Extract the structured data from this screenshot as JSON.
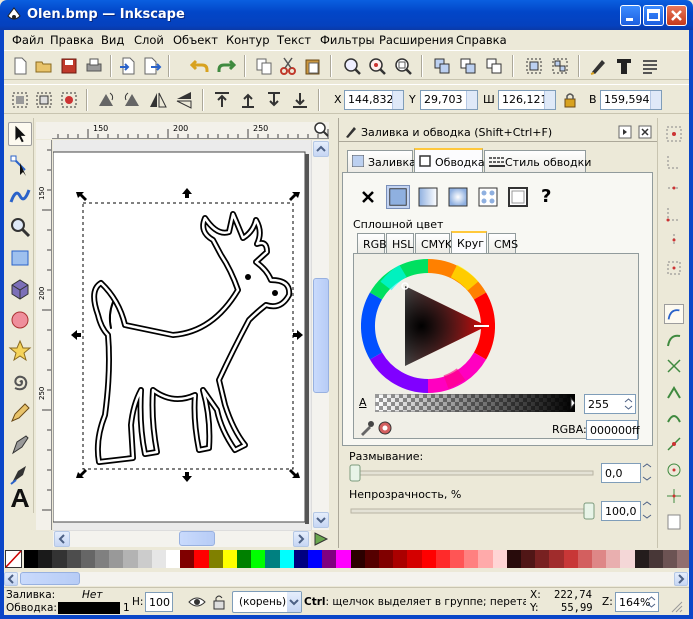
{
  "window": {
    "title": "Olen.bmp — Inkscape",
    "title_icon": "inkscape-icon",
    "controls": [
      "minimize-icon",
      "maximize-icon",
      "close-icon"
    ]
  },
  "menu": [
    "Файл",
    "Правка",
    "Вид",
    "Слой",
    "Объект",
    "Контур",
    "Текст",
    "Фильтры",
    "Расширения",
    "Справка"
  ],
  "toolbar_main": {
    "icons": [
      "new-icon",
      "open-icon",
      "save-icon",
      "print-icon",
      "import-icon",
      "export-icon",
      "undo-icon",
      "redo-icon",
      "copy-icon",
      "cut-icon",
      "paste-icon",
      "zoom-selection-icon",
      "zoom-drawing-icon",
      "zoom-page-icon",
      "duplicate-icon",
      "clone-icon",
      "unlink-clone-icon",
      "group-icon",
      "ungroup-icon",
      "fill-stroke-icon",
      "text-font-icon",
      "xml-editor-icon"
    ]
  },
  "toolbar_select": {
    "x_label": "X",
    "x_value": "144,832",
    "y_label": "Y",
    "y_value": "29,703",
    "w_label": "Ш",
    "w_value": "126,121",
    "h_label": "В",
    "h_value": "159,594",
    "lock_icon": "lock-icon"
  },
  "rulers": {
    "h_labels": [
      "150",
      "200",
      "250"
    ],
    "v_labels": [
      "150",
      "200",
      "250"
    ]
  },
  "left_tools": [
    "selector-tool-icon",
    "node-tool-icon",
    "tweak-tool-icon",
    "zoom-tool-icon",
    "rect-tool-icon",
    "3dbox-tool-icon",
    "ellipse-tool-icon",
    "star-tool-icon",
    "spiral-tool-icon",
    "pencil-tool-icon",
    "pen-tool-icon",
    "calligraphy-tool-icon",
    "text-tool-icon"
  ],
  "dock": {
    "title": "Заливка и обводка (Shift+Ctrl+F)",
    "tabs": [
      "Заливка",
      "Обводка",
      "Стиль обводки"
    ],
    "active_tab": "Обводка",
    "paint_modes": [
      "no-paint",
      "flat-color",
      "linear-gradient",
      "radial-gradient",
      "pattern",
      "swatch",
      "unset"
    ],
    "unset_glyph": "?",
    "section_label": "Сплошной цвет",
    "color_tabs": [
      "RGB",
      "HSL",
      "CMYK",
      "Круг",
      "CMS"
    ],
    "active_color_tab": "Круг",
    "alpha_label": "A",
    "alpha_value": "255",
    "rgba_label": "RGBA:",
    "rgba_value": "000000ff",
    "blur_label": "Размывание:",
    "blur_value": "0,0",
    "blur_level": 0,
    "opacity_label": "Непрозрачность, %",
    "opacity_value": "100,0",
    "opacity_level": 1,
    "accent_color": "#ffc83c"
  },
  "palette": {
    "colors": [
      "#000000",
      "#1a1a1a",
      "#333333",
      "#4d4d4d",
      "#666666",
      "#808080",
      "#999999",
      "#b3b3b3",
      "#cccccc",
      "#e6e6e6",
      "#ffffff",
      "#800000",
      "#ff0000",
      "#808000",
      "#ffff00",
      "#008000",
      "#00ff00",
      "#008080",
      "#00ffff",
      "#000080",
      "#0000ff",
      "#800080",
      "#ff00ff",
      "#2b0000",
      "#550000",
      "#800000",
      "#aa0000",
      "#d40000",
      "#ff0000",
      "#ff2a2a",
      "#ff5555",
      "#ff8080",
      "#ffaaaa",
      "#ffd5d5",
      "#280b0b",
      "#501616",
      "#782121",
      "#a02c2c",
      "#c83737",
      "#d35f5f",
      "#de8787",
      "#e9afaf",
      "#f4d7d7",
      "#241c1c",
      "#483737",
      "#6c5353",
      "#916f6f"
    ]
  },
  "status": {
    "fill_label": "Заливка:",
    "fill_value": "Нет",
    "stroke_label": "Обводка:",
    "stroke_width": "1",
    "opacity_label": "Н:",
    "opacity_value": "100",
    "layer_value": "(корень)",
    "message_bold": "Ctrl",
    "message": ": щелчок выделяет в группе; перетаск",
    "x_label": "X:",
    "x_value": "222,74",
    "y_label": "Y:",
    "y_value": "55,99",
    "zoom_label": "Z:",
    "zoom_value": "164%"
  }
}
